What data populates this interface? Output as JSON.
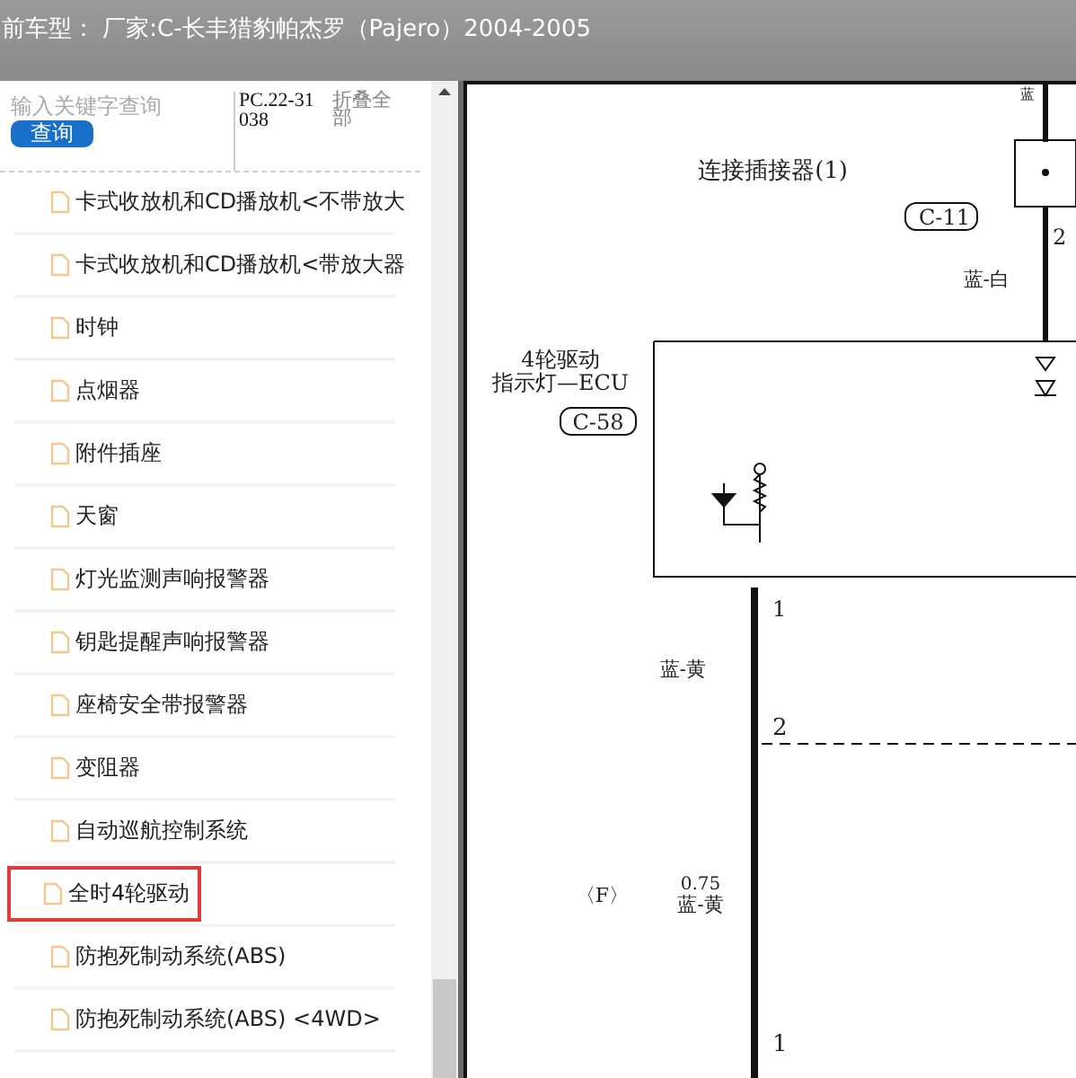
{
  "title_bar": {
    "text": "前车型： 厂家:C-长丰猎豹帕杰罗（Pajero）2004-2005"
  },
  "sidebar": {
    "search": {
      "placeholder": "输入关键字查询"
    },
    "search_button": "查询",
    "code": "PC.22-31038",
    "collapse_all": "折叠全部",
    "items": [
      {
        "label": "卡式收放机和CD播放机<不带放大",
        "highlighted": false
      },
      {
        "label": "卡式收放机和CD播放机<带放大器",
        "highlighted": false
      },
      {
        "label": "时钟",
        "highlighted": false
      },
      {
        "label": "点烟器",
        "highlighted": false
      },
      {
        "label": "附件插座",
        "highlighted": false
      },
      {
        "label": "天窗",
        "highlighted": false
      },
      {
        "label": "灯光监测声响报警器",
        "highlighted": false
      },
      {
        "label": "钥匙提醒声响报警器",
        "highlighted": false
      },
      {
        "label": "座椅安全带报警器",
        "highlighted": false
      },
      {
        "label": "变阻器",
        "highlighted": false
      },
      {
        "label": "自动巡航控制系统",
        "highlighted": false
      },
      {
        "label": "全时4轮驱动",
        "highlighted": true
      },
      {
        "label": "防抱死制动系统(ABS)",
        "highlighted": false
      },
      {
        "label": "防抱死制动系统(ABS) <4WD>",
        "highlighted": false
      }
    ]
  },
  "diagram": {
    "labels": [
      "蓝",
      "连接插接器(1)",
      "C-11",
      "2",
      "蓝-白",
      "4轮驱动",
      "指示灯—ECU",
      "C-58",
      "1",
      "蓝-黄",
      "2",
      "〈F〉",
      "0.75",
      "蓝-黄",
      "1"
    ]
  }
}
